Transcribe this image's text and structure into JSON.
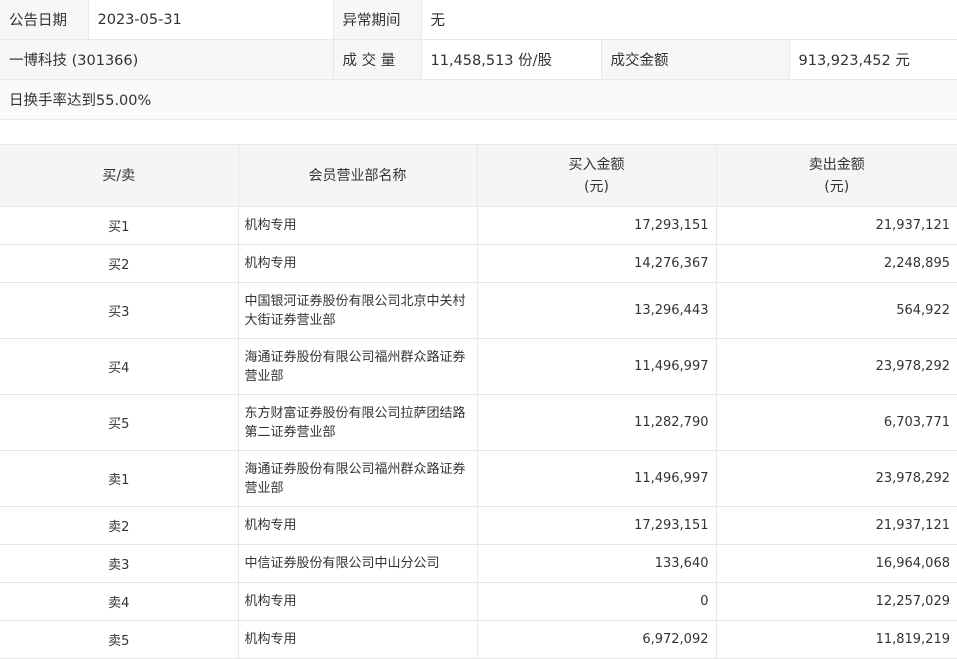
{
  "summary": {
    "announce_date_label": "公告日期",
    "announce_date": "2023-05-31",
    "abnormal_period_label": "异常期间",
    "abnormal_period": "无",
    "stock": "一博科技 (301366)",
    "volume_label": "成 交 量",
    "volume": "11,458,513 份/股",
    "amount_label": "成交金额",
    "amount": "913,923,452 元",
    "reason": "日换手率达到55.00%"
  },
  "table": {
    "headers": {
      "side": "买/卖",
      "branch": "会员营业部名称",
      "buy_title": "买入金额",
      "buy_unit": "(元)",
      "sell_title": "卖出金额",
      "sell_unit": "(元)"
    },
    "rows": [
      {
        "side": "买1",
        "branch": "机构专用",
        "buy": "17,293,151",
        "sell": "21,937,121"
      },
      {
        "side": "买2",
        "branch": "机构专用",
        "buy": "14,276,367",
        "sell": "2,248,895"
      },
      {
        "side": "买3",
        "branch": "中国银河证券股份有限公司北京中关村大街证券营业部",
        "buy": "13,296,443",
        "sell": "564,922"
      },
      {
        "side": "买4",
        "branch": "海通证券股份有限公司福州群众路证券营业部",
        "buy": "11,496,997",
        "sell": "23,978,292"
      },
      {
        "side": "买5",
        "branch": "东方财富证券股份有限公司拉萨团结路第二证券营业部",
        "buy": "11,282,790",
        "sell": "6,703,771"
      },
      {
        "side": "卖1",
        "branch": "海通证券股份有限公司福州群众路证券营业部",
        "buy": "11,496,997",
        "sell": "23,978,292"
      },
      {
        "side": "卖2",
        "branch": "机构专用",
        "buy": "17,293,151",
        "sell": "21,937,121"
      },
      {
        "side": "卖3",
        "branch": "中信证券股份有限公司中山分公司",
        "buy": "133,640",
        "sell": "16,964,068"
      },
      {
        "side": "卖4",
        "branch": "机构专用",
        "buy": "0",
        "sell": "12,257,029"
      },
      {
        "side": "卖5",
        "branch": "机构专用",
        "buy": "6,972,092",
        "sell": "11,819,219"
      }
    ]
  }
}
